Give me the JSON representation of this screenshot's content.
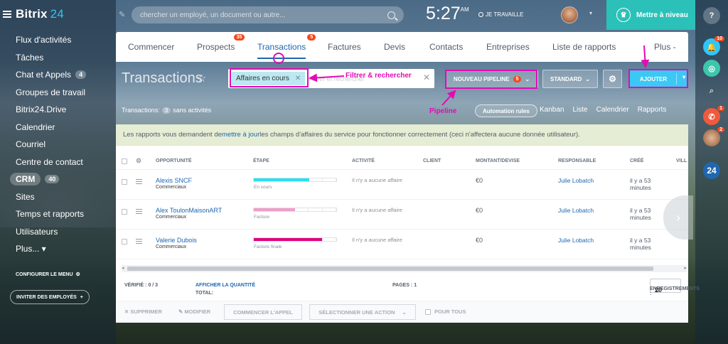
{
  "app": {
    "name": "Bitrix",
    "version": "24"
  },
  "sidebar": {
    "items": [
      {
        "label": "Flux d'activités"
      },
      {
        "label": "Tâches"
      },
      {
        "label": "Chat et Appels",
        "badge": "4"
      },
      {
        "label": "Groupes de travail"
      },
      {
        "label": "Bitrix24.Drive"
      },
      {
        "label": "Calendrier"
      },
      {
        "label": "Courriel"
      },
      {
        "label": "Centre de contact"
      },
      {
        "label": "CRM",
        "badge": "40",
        "active": true
      },
      {
        "label": "Sites"
      },
      {
        "label": "Temps et rapports"
      },
      {
        "label": "Utilisateurs"
      },
      {
        "label": "Plus... ▾"
      }
    ],
    "configure_label": "CONFIGURER LE MENU",
    "invite_label": "INVITER DES EMPLOYÉS"
  },
  "topbar": {
    "search_placeholder": "chercher un employé, un document ou autre...",
    "time": "5:27",
    "ampm": "AM",
    "work_status": "JE TRAVAILLE",
    "upgrade_label": "Mettre à niveau"
  },
  "rail": {
    "badges": [
      "10",
      "1",
      "2"
    ],
    "logo_text": "24"
  },
  "tabs": [
    {
      "label": "Commencer"
    },
    {
      "label": "Prospects",
      "badge": "35"
    },
    {
      "label": "Transactions",
      "badge": "5",
      "active": true
    },
    {
      "label": "Factures"
    },
    {
      "label": "Devis"
    },
    {
      "label": "Contacts"
    },
    {
      "label": "Entreprises"
    },
    {
      "label": "Liste de rapports"
    },
    {
      "label": "Plus -"
    }
  ],
  "header": {
    "title": "Transactions",
    "filter_chip": "Affaires en cours",
    "filter_rest": "Filtrer et rechercher",
    "pipeline_label": "NOUVEAU PIPELINE",
    "pipeline_badge": "5",
    "standard_label": "STANDARD",
    "add_label": "AJOUTER"
  },
  "annotations": {
    "filter": "Filtrer & rechercher",
    "pipeline": "Pipeline",
    "color": "#e40ab6"
  },
  "subbar": {
    "prefix": "Transactions:",
    "count": "3",
    "suffix": "sans activités",
    "automation_label": "Automation rules",
    "views": [
      "Kanban",
      "Liste",
      "Calendrier",
      "Rapports"
    ]
  },
  "notice": {
    "before": "Les rapports vous demandent de ",
    "link": "mettre à jour",
    "after": " les champs d'affaires du service pour fonctionner correctement (ceci n'affectera aucune donnée utilisateur)."
  },
  "table": {
    "columns": [
      "OPPORTUNITÉ",
      "ÉTAPE",
      "ACTIVITÉ",
      "CLIENT",
      "MONTANT/DEVISE",
      "RESPONSABLE",
      "CRÉÉ",
      "VILL"
    ],
    "rows": [
      {
        "title": "Alexis SNCF",
        "subtitle": "Commerciaux",
        "stage": "En cours",
        "stage_progress": 0.67,
        "stage_color": "#27e0f0",
        "activity": "Il n'y a aucune affaire",
        "amount": "€0",
        "responsible": "Julie Lobatch",
        "created": "il y a 53 minutes"
      },
      {
        "title": "Alex ToulonMaisonART",
        "subtitle": "Commerciaux",
        "stage": "Facture",
        "stage_progress": 0.5,
        "stage_color": "#ef9ec9",
        "activity": "Il n'y a aucune affaire",
        "amount": "€0",
        "responsible": "Julie Lobatch",
        "created": "il y a 53 minutes"
      },
      {
        "title": "Valerie Dubois",
        "subtitle": "Commerciaux",
        "stage": "Facture finale",
        "stage_progress": 0.83,
        "stage_color": "#e0007a",
        "activity": "Il n'y a aucune affaire",
        "amount": "€0",
        "responsible": "Julie Lobatch",
        "created": "il y a 53 minutes"
      }
    ]
  },
  "footer": {
    "verified": "VÉRIFIÉ : 0 / 3",
    "total_label": "TOTAL:",
    "total_link": "AFFICHER LA QUANTITÉ",
    "pages": "PAGES : 1",
    "records_label": "ENREGISTREMENTS :",
    "records_value": "20"
  },
  "actions": {
    "delete": "SUPPRIMER",
    "edit": "MODIFIER",
    "call": "COMMENCER L'APPEL",
    "select_action": "SÉLECTIONNER UNE ACTION",
    "for_all": "POUR TOUS"
  }
}
